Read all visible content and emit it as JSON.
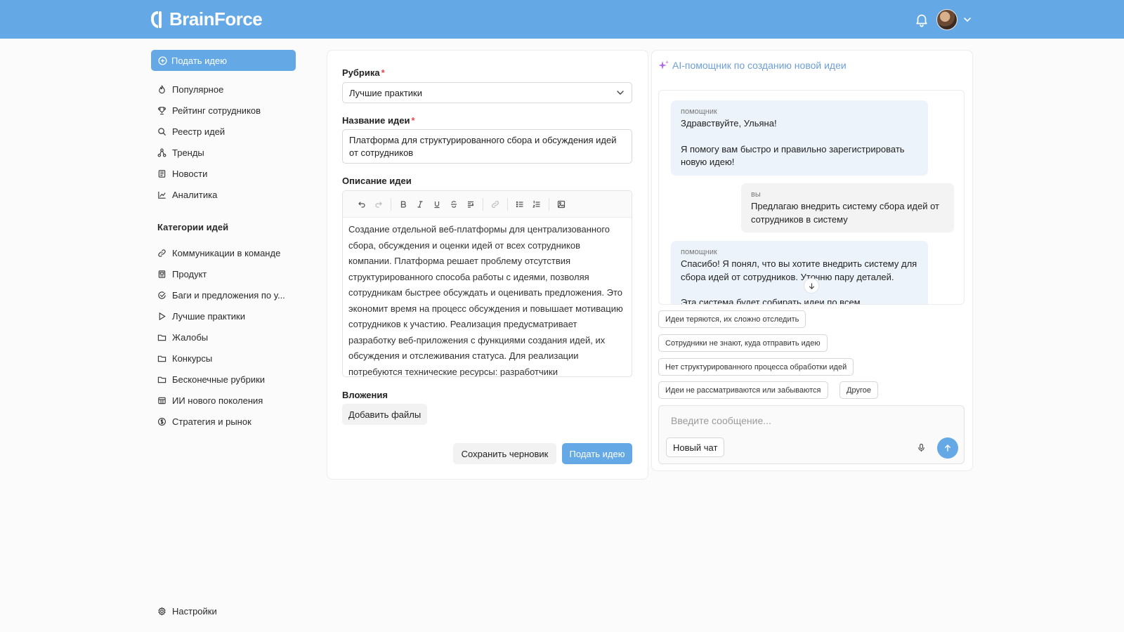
{
  "header": {
    "logo_text": "BrainForce",
    "colors": {
      "brand": "#64a9e5"
    }
  },
  "sidebar": {
    "submit_label": "Подать идею",
    "items": [
      {
        "label": "Популярное",
        "icon": "flame-icon"
      },
      {
        "label": "Рейтинг сотрудников",
        "icon": "trophy-icon"
      },
      {
        "label": "Реестр идей",
        "icon": "search-icon"
      },
      {
        "label": "Тренды",
        "icon": "network-icon"
      },
      {
        "label": "Новости",
        "icon": "newspaper-icon"
      },
      {
        "label": "Аналитика",
        "icon": "chart-icon"
      }
    ],
    "categories_title": "Категории идей",
    "categories": [
      {
        "label": "Коммуникации в команде",
        "icon": "link-icon"
      },
      {
        "label": "Продукт",
        "icon": "box-icon"
      },
      {
        "label": "Баги и предложения по у...",
        "icon": "check-circle-icon"
      },
      {
        "label": "Лучшие практики",
        "icon": "play-icon"
      },
      {
        "label": "Жалобы",
        "icon": "folder-icon"
      },
      {
        "label": "Конкурсы",
        "icon": "folder-icon"
      },
      {
        "label": "Бесконечные рубрики",
        "icon": "folder-icon"
      },
      {
        "label": "ИИ нового поколения",
        "icon": "grid-icon"
      },
      {
        "label": "Стратегия и рынок",
        "icon": "coin-icon"
      }
    ],
    "settings_label": "Настройки"
  },
  "form": {
    "category_label": "Рубрика",
    "category_value": "Лучшие практики",
    "title_label": "Название идеи",
    "title_value": "Платформа для структурированного сбора и обсуждения идей от сотрудников",
    "description_label": "Описание идеи",
    "description_value": "Создание отдельной веб-платформы для централизованного сбора, обсуждения и оценки идей от всех сотрудников компании. Платформа решает проблему отсутствия структурированного способа работы с идеями, позволяя сотрудникам быстрее обсуждать и оценивать предложения. Это экономит время на процесс обсуждения и повышает мотивацию сотрудников к участию. Реализация предусматривает разработку веб-приложения с функциями создания идей, их обсуждения и отслеживания статуса. Для реализации потребуются технические ресурсы: разработчики",
    "attachments_label": "Вложения",
    "add_files_label": "Добавить файлы",
    "save_draft_label": "Сохранить черновик",
    "submit_label": "Подать идею",
    "required_mark": "*"
  },
  "ai": {
    "title": "AI-помощник по созданию новой идеи",
    "messages": [
      {
        "author": "помощник",
        "text1": "Здравствуйте, Ульяна!",
        "text2": "Я помогу вам быстро и правильно зарегистрировать новую идею!"
      },
      {
        "author": "вы",
        "text1": "Предлагаю внедрить систему сбора идей от сотрудников в систему"
      },
      {
        "author": "помощник",
        "text1": "Спасибо! Я понял, что вы хотите внедрить систему для сбора идей от сотрудников. Уточню пару деталей.",
        "text2": "Эта система будет собирать идеи по всем"
      }
    ],
    "chips": [
      "Идеи теряются, их сложно отследить",
      "Сотрудники не знают, куда отправить идею",
      "Нет структурированного процесса обработки идей",
      "Идеи не рассматриваются или забываются",
      "Другое"
    ],
    "input_placeholder": "Введите сообщение...",
    "new_chat_label": "Новый чат"
  }
}
